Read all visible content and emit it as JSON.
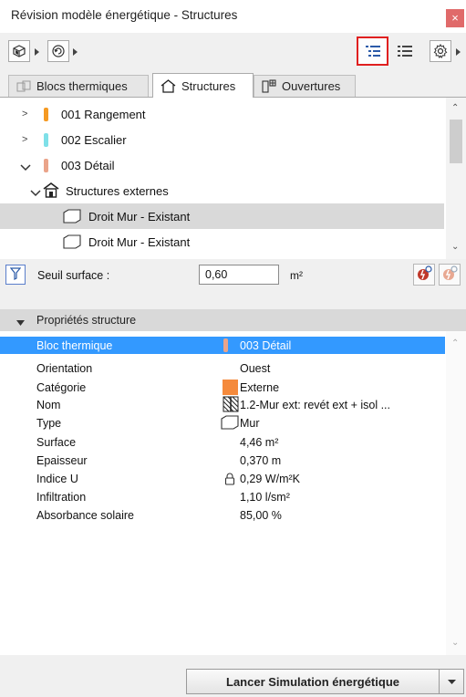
{
  "window": {
    "title": "Révision modèle énergétique - Structures",
    "close_glyph": "×"
  },
  "toolbar": {
    "left_icons": [
      "3d-view-icon",
      "refresh-icon"
    ],
    "right_icons": [
      "tree-view-icon",
      "list-view-icon",
      "gear-icon"
    ],
    "highlight_color": "#e02020"
  },
  "tabs": [
    {
      "label": "Blocs thermiques",
      "icon": "thermal-blocks-icon",
      "active": false
    },
    {
      "label": "Structures",
      "icon": "house-icon",
      "active": true
    },
    {
      "label": "Ouvertures",
      "icon": "openings-icon",
      "active": false
    }
  ],
  "tree": {
    "items": [
      {
        "label": "001 Rangement",
        "color": "#f59a23",
        "expanded": false
      },
      {
        "label": "002 Escalier",
        "color": "#7fe0e8",
        "expanded": false
      },
      {
        "label": "003 Détail",
        "color": "#eaa48a",
        "expanded": true
      },
      {
        "label": "Structures externes",
        "expanded": true
      },
      {
        "label": "Droit Mur - Existant",
        "selected": true
      },
      {
        "label": "Droit Mur - Existant",
        "selected": false
      }
    ]
  },
  "threshold": {
    "label": "Seuil surface :",
    "value": "0,60",
    "unit": "m²"
  },
  "properties": {
    "header": "Propriétés structure",
    "rows": [
      {
        "key": "Bloc thermique",
        "value": "003 Détail",
        "color": "#eaa48a"
      },
      {
        "key": "Orientation",
        "value": "Ouest"
      },
      {
        "key": "Catégorie",
        "value": "Externe",
        "color": "#f58a3c"
      },
      {
        "key": "Nom",
        "value": "1.2-Mur ext: revét ext + isol ..."
      },
      {
        "key": "Type",
        "value": "Mur"
      },
      {
        "key": "Surface",
        "value": "4,46 m²"
      },
      {
        "key": "Epaisseur",
        "value": "0,370 m"
      },
      {
        "key": "Indice U",
        "value": "0,29 W/m²K"
      },
      {
        "key": "Infiltration",
        "value": "1,10 l/sm²"
      },
      {
        "key": "Absorbance solaire",
        "value": "85,00 %"
      }
    ]
  },
  "bottom": {
    "launch_label": "Lancer Simulation énergétique"
  }
}
